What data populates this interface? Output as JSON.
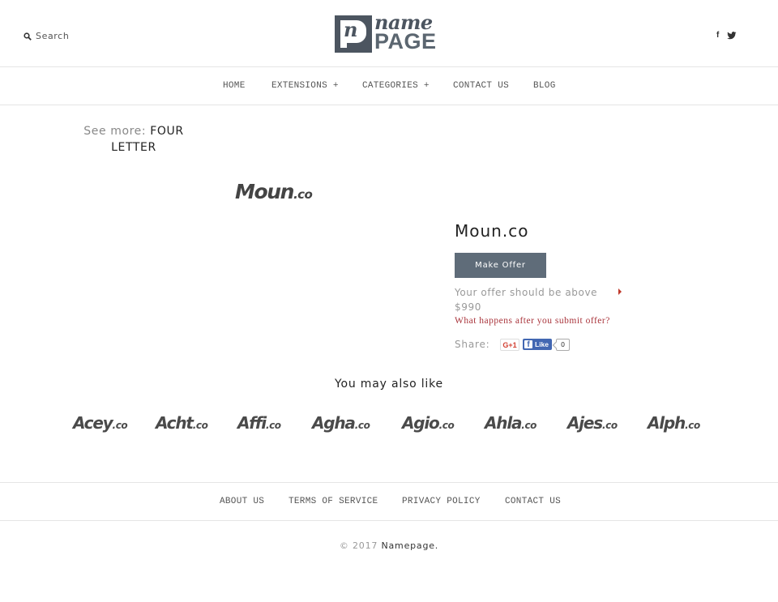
{
  "header": {
    "search_label": "Search",
    "search_icon": "search-icon",
    "logo": {
      "mark": "n",
      "name": "name",
      "page": "PAGE"
    },
    "social": [
      {
        "icon": "facebook-icon",
        "glyph": "f"
      },
      {
        "icon": "twitter-icon"
      }
    ]
  },
  "nav": {
    "items": [
      {
        "label": "HOME"
      },
      {
        "label": "EXTENSIONS +"
      },
      {
        "label": "CATEGORIES +"
      },
      {
        "label": "CONTACT US"
      },
      {
        "label": "BLOG"
      }
    ]
  },
  "see_more": {
    "label": "See more:",
    "link": "FOUR LETTER"
  },
  "product": {
    "logo_name": "Moun",
    "logo_tld": ".co",
    "title": "Moun.co",
    "make_offer_label": "Make Offer",
    "offer_note": "Your offer should be above $990",
    "what_happens_link": "What happens after you submit offer?",
    "share_label": "Share:",
    "gplus_label": "G+1",
    "fb_like_label": "Like",
    "fb_like_glyph": "f",
    "fb_like_count": "0"
  },
  "related": {
    "heading": "You may also like",
    "items": [
      {
        "name": "Acey",
        "tld": ".co"
      },
      {
        "name": "Acht",
        "tld": ".co"
      },
      {
        "name": "Affi",
        "tld": ".co"
      },
      {
        "name": "Agha",
        "tld": ".co"
      },
      {
        "name": "Agio",
        "tld": ".co"
      },
      {
        "name": "Ahla",
        "tld": ".co"
      },
      {
        "name": "Ajes",
        "tld": ".co"
      },
      {
        "name": "Alph",
        "tld": ".co"
      }
    ]
  },
  "footer": {
    "items": [
      {
        "label": "ABOUT US"
      },
      {
        "label": "TERMS OF SERVICE"
      },
      {
        "label": "PRIVACY POLICY"
      },
      {
        "label": "CONTACT US"
      }
    ],
    "copyright": "© 2017",
    "brand": "Namepage."
  },
  "colors": {
    "button_bg": "#5f6c79",
    "link_red": "#a9343b",
    "logo_dark": "#4c5560",
    "facebook_blue": "#4267b2",
    "gplus_red": "#d23f31"
  }
}
